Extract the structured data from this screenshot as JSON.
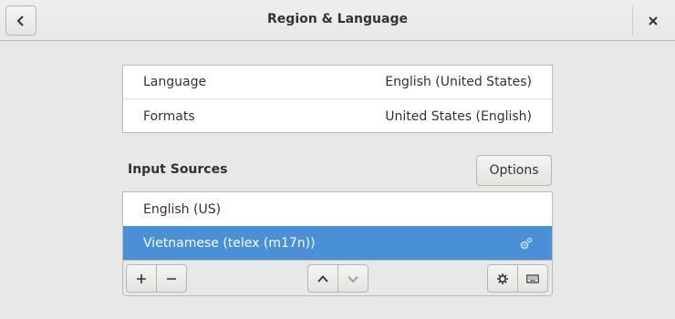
{
  "header": {
    "title": "Region & Language",
    "back_icon": "chevron-left-icon",
    "close_icon": "close-icon"
  },
  "locale": {
    "rows": [
      {
        "label": "Language",
        "value": "English (United States)"
      },
      {
        "label": "Formats",
        "value": "United States (English)"
      }
    ]
  },
  "input_sources": {
    "heading": "Input Sources",
    "options_label": "Options",
    "items": [
      {
        "label": "English (US)",
        "selected": false
      },
      {
        "label": "Vietnamese (telex (m17n))",
        "selected": true,
        "icon": "gears-icon"
      }
    ],
    "toolbar_icons": [
      "plus-icon",
      "minus-icon",
      "arrow-up-icon",
      "arrow-down-icon",
      "gear-icon",
      "keyboard-icon"
    ]
  },
  "colors": {
    "selection": "#4a90d9",
    "background": "#e8e8e7",
    "text": "#2e3436"
  }
}
